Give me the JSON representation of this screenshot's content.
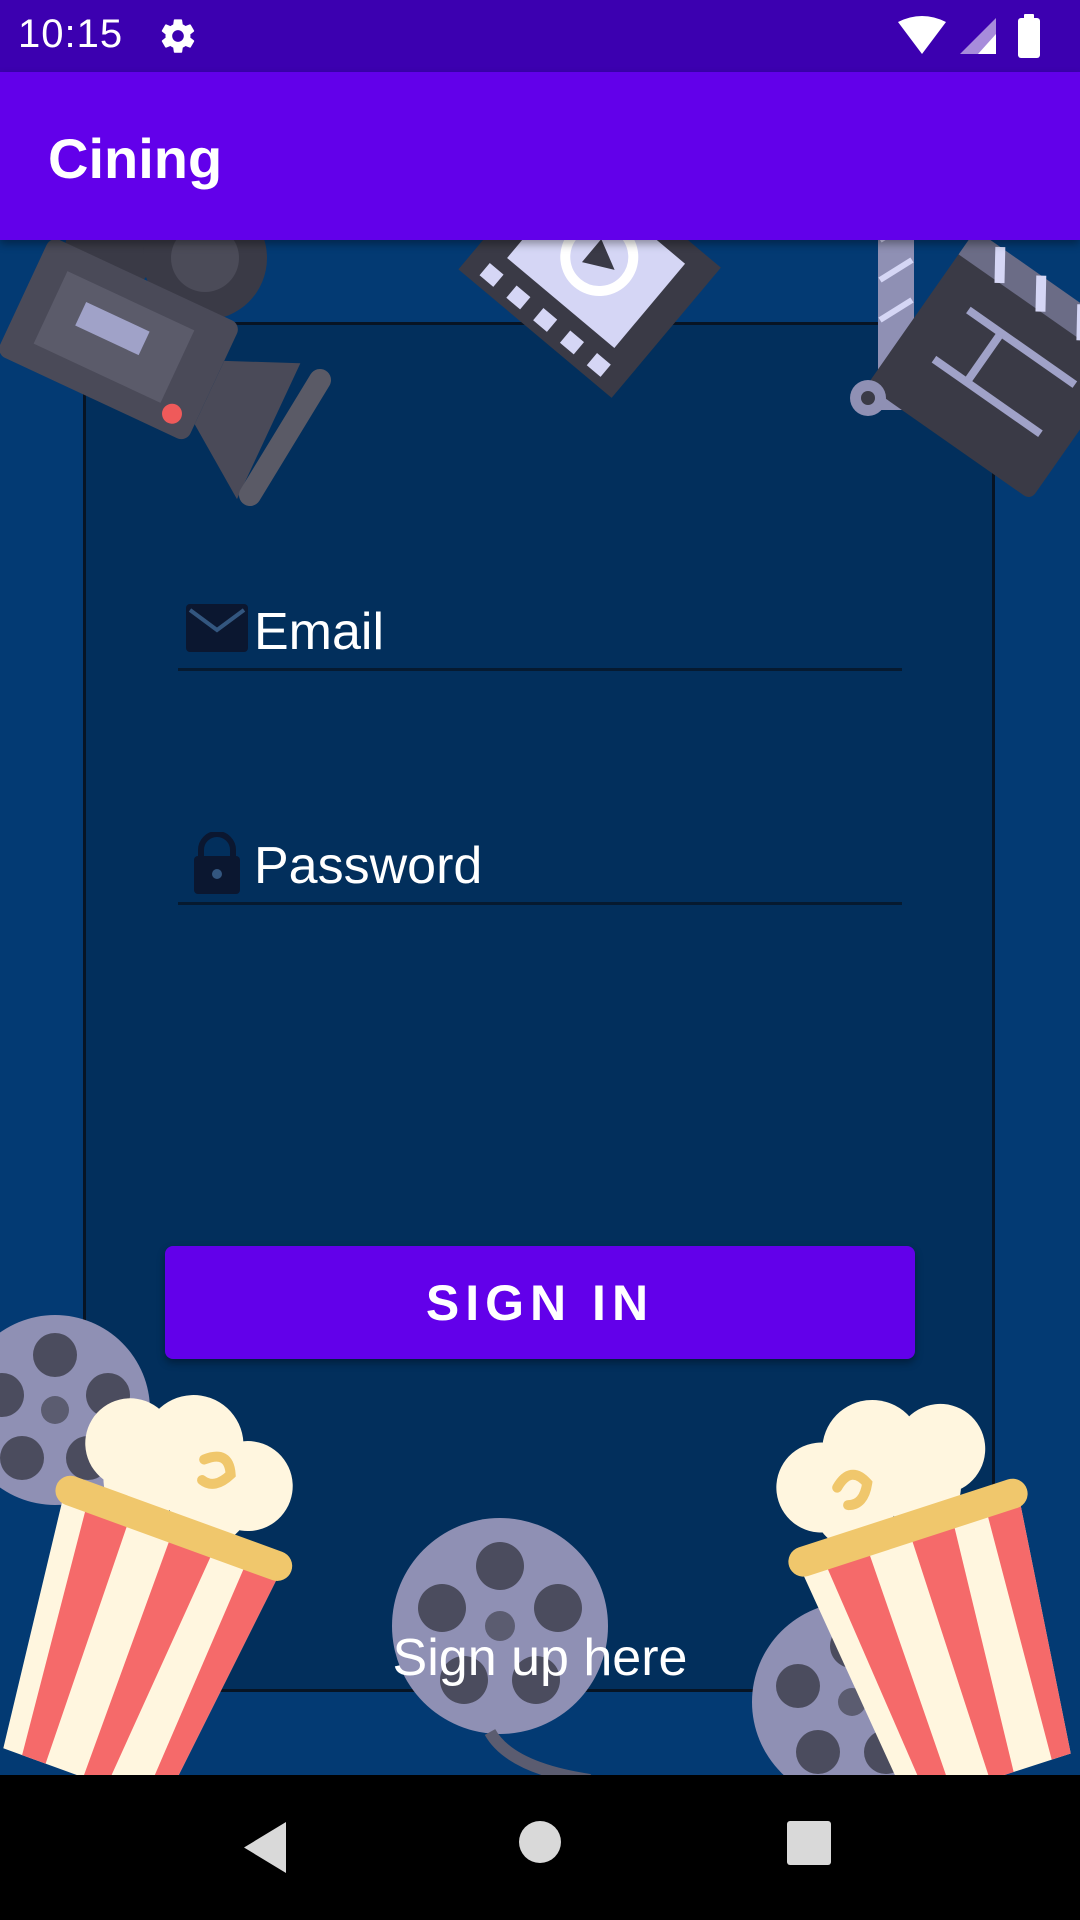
{
  "status_bar": {
    "time": "10:15",
    "icons": [
      "gear-icon",
      "wifi-icon",
      "cellular-signal-icon",
      "battery-icon"
    ]
  },
  "app_bar": {
    "title": "Cining"
  },
  "login": {
    "email_placeholder": "Email",
    "password_placeholder": "Password",
    "sign_in_label": "SIGN IN",
    "sign_up_link": "Sign up here"
  },
  "navigation": {
    "buttons": [
      "back-icon",
      "home-icon",
      "recents-icon"
    ]
  },
  "colors": {
    "primary": "#6200ea",
    "status_bar": "#3c00b0",
    "background": "#033a73",
    "panel": "#022f5c"
  }
}
